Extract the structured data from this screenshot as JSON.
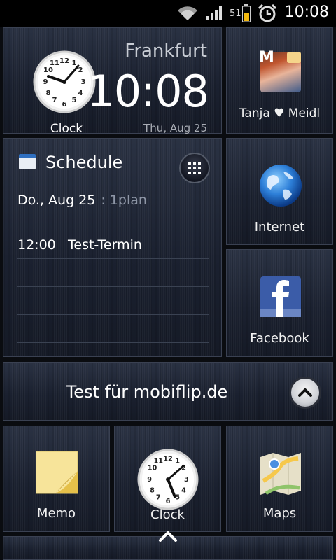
{
  "status_bar": {
    "time": "10:08",
    "battery_level": "51",
    "icons": [
      "wifi-icon",
      "signal-icon",
      "battery-icon",
      "alarm-icon"
    ]
  },
  "clock_widget": {
    "city": "Frankfurt",
    "time": "10:08",
    "date": "Thu, Aug 25",
    "label": "Clock"
  },
  "contact_widget": {
    "name": "Tanja ♥ Meidl",
    "badge": "M"
  },
  "schedule_widget": {
    "title": "Schedule",
    "date": "Do., Aug 25",
    "calendar_name": ": 1plan",
    "events": [
      {
        "time": "12:00",
        "title": "Test-Termin"
      }
    ]
  },
  "internet_widget": {
    "label": "Internet"
  },
  "facebook_widget": {
    "label": "Facebook"
  },
  "note_widget": {
    "text": "Test für mobiflip.de"
  },
  "bottom_apps": [
    {
      "label": "Memo"
    },
    {
      "label": "Clock"
    },
    {
      "label": "Maps"
    }
  ],
  "colors": {
    "tile_bg": "#1e2432",
    "tile_border": "#3a4152",
    "accent_blue": "#2f6fc0",
    "battery": "#f2b90f"
  }
}
